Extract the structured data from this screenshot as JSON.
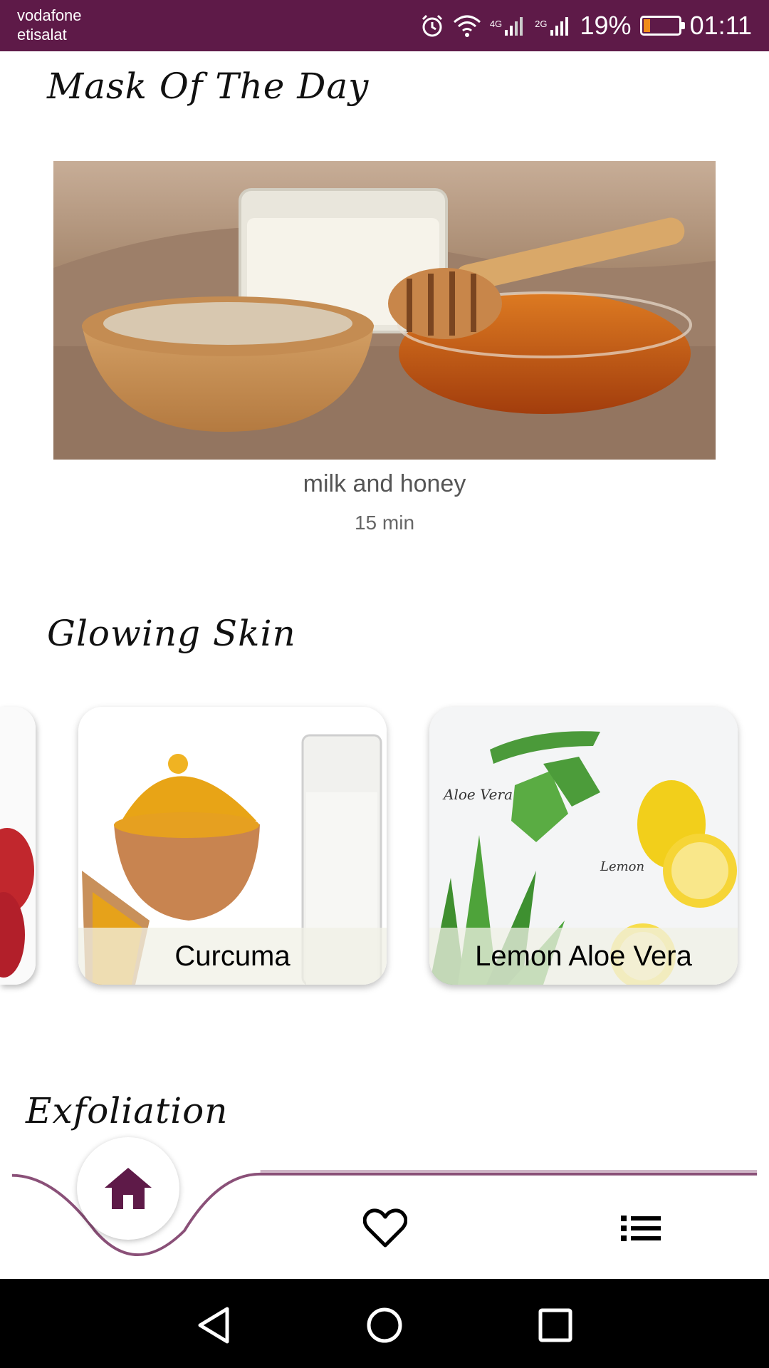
{
  "status": {
    "carrier_line1": "vodafone",
    "carrier_line2": "etisalat",
    "network1": "4G",
    "network2": "2G",
    "battery_percent": "19%",
    "battery_level": 0.19,
    "time": "01:11",
    "bar_color": "#5e1a48"
  },
  "sections": {
    "mask_of_day": "Mask Of The Day",
    "glowing_skin": "Glowing Skin",
    "exfoliation": "Exfoliation"
  },
  "mask_of_day": {
    "name": "milk and honey",
    "duration": "15 min"
  },
  "glowing_cards": [
    {
      "label": "Curcuma"
    },
    {
      "label": "Lemon Aloe Vera"
    }
  ],
  "aloe_vera_label": "Aloe Vera",
  "lemon_label": "Lemon",
  "bottom_nav": {
    "items": [
      "home-icon",
      "heart-icon",
      "list-icon"
    ],
    "accent": "#5e1a48"
  },
  "system_nav": [
    "back-icon",
    "home-circle-icon",
    "recents-icon"
  ]
}
